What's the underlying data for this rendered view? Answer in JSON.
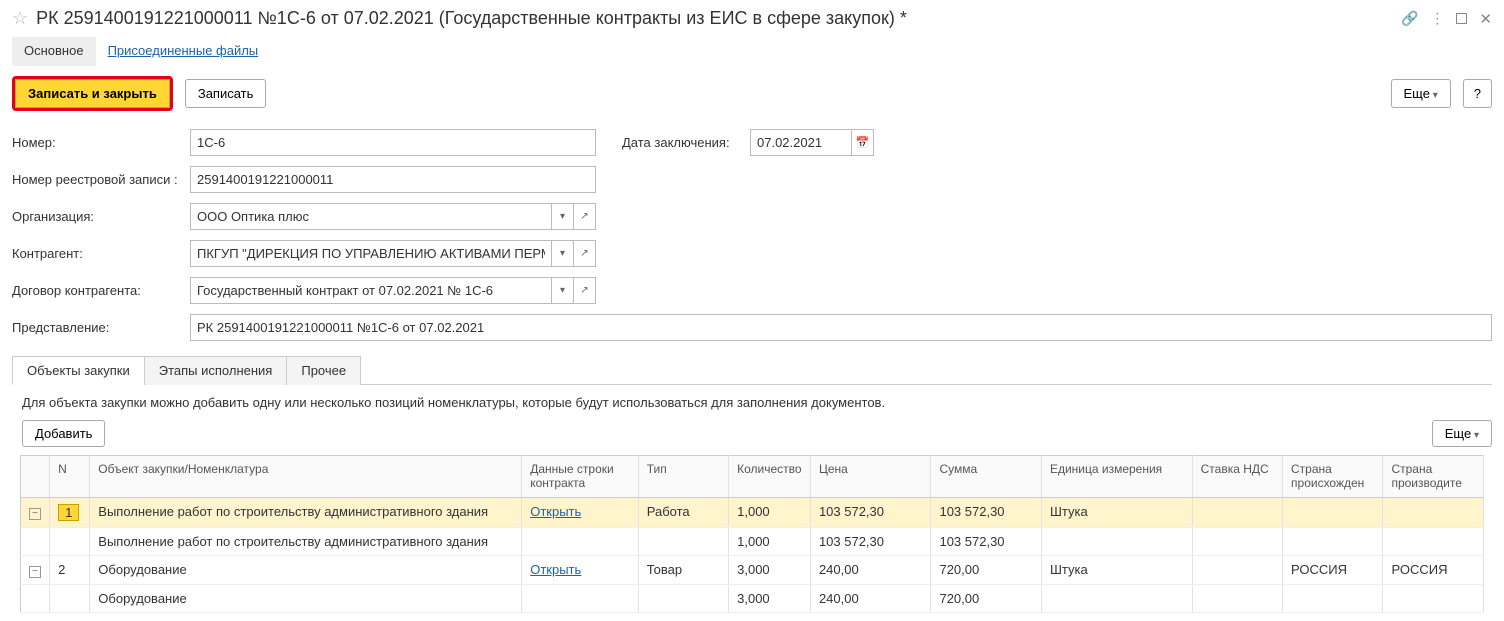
{
  "header": {
    "title": "РК 2591400191221000011 №1С-6 от 07.02.2021 (Государственные контракты из ЕИС в сфере закупок) *"
  },
  "top_tabs": {
    "main": "Основное",
    "files": "Присоединенные файлы"
  },
  "actions": {
    "save_close": "Записать и закрыть",
    "save": "Записать",
    "more": "Еще",
    "help": "?"
  },
  "form": {
    "number_label": "Номер:",
    "number_value": "1C-6",
    "date_label": "Дата заключения:",
    "date_value": "07.02.2021",
    "registry_label": "Номер реестровой записи :",
    "registry_value": "2591400191221000011",
    "org_label": "Организация:",
    "org_value": "ООО Оптика плюс",
    "counterparty_label": "Контрагент:",
    "counterparty_value": "ПКГУП \"ДИРЕКЦИЯ ПО УПРАВЛЕНИЮ АКТИВАМИ ПЕРМС",
    "contract_label": "Договор контрагента:",
    "contract_value": "Государственный контракт от 07.02.2021 № 1С-6",
    "repr_label": "Представление:",
    "repr_value": "РК 2591400191221000011 №1С-6 от 07.02.2021"
  },
  "inner_tabs": {
    "objects": "Объекты закупки",
    "stages": "Этапы исполнения",
    "other": "Прочее"
  },
  "hint": "Для объекта закупки можно добавить одну или несколько позиций номенклатуры, которые будут использоваться для заполнения документов.",
  "table_actions": {
    "add": "Добавить",
    "more": "Еще"
  },
  "columns": {
    "n": "N",
    "object": "Объект закупки/Номенклатура",
    "contract_line": "Данные строки контракта",
    "type": "Тип",
    "qty": "Количество",
    "price": "Цена",
    "sum": "Сумма",
    "unit": "Единица измерения",
    "vat": "Ставка НДС",
    "origin": "Страна происхожден",
    "manuf": "Страна производите"
  },
  "rows": [
    {
      "n": "1",
      "object": "Выполнение работ по строительству административного здания",
      "open": "Открыть",
      "type": "Работа",
      "qty": "1,000",
      "price": "103 572,30",
      "sum": "103 572,30",
      "unit": "Штука",
      "vat": "",
      "origin": "",
      "manuf": "",
      "current": true
    },
    {
      "n": "",
      "object": "Выполнение работ по строительству административного здания",
      "open": "",
      "type": "",
      "qty": "1,000",
      "price": "103 572,30",
      "sum": "103 572,30",
      "unit": "",
      "vat": "",
      "origin": "",
      "manuf": "",
      "child": true
    },
    {
      "n": "2",
      "object": "Оборудование",
      "open": "Открыть",
      "type": "Товар",
      "qty": "3,000",
      "price": "240,00",
      "sum": "720,00",
      "unit": "Штука",
      "vat": "",
      "origin": "РОССИЯ",
      "manuf": "РОССИЯ"
    },
    {
      "n": "",
      "object": "Оборудование",
      "open": "",
      "type": "",
      "qty": "3,000",
      "price": "240,00",
      "sum": "720,00",
      "unit": "",
      "vat": "",
      "origin": "",
      "manuf": "",
      "child": true
    }
  ]
}
